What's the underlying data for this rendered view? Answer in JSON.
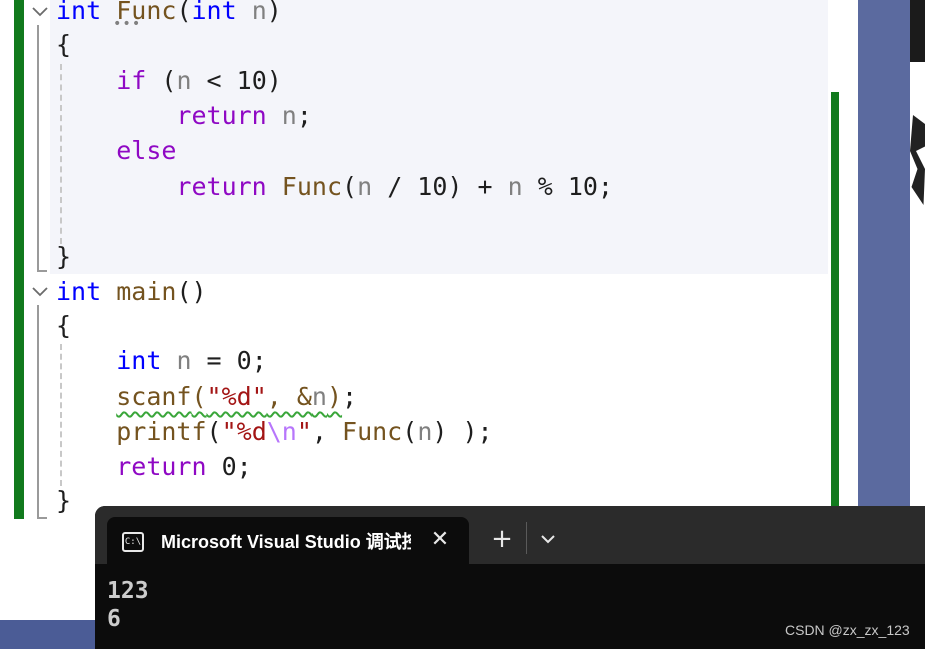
{
  "editor": {
    "lines": [
      {
        "tokens": [
          {
            "t": "int",
            "c": "kw"
          },
          {
            "t": " "
          },
          {
            "t": "Func",
            "c": "fn"
          },
          {
            "t": "("
          },
          {
            "t": "int",
            "c": "kw"
          },
          {
            "t": " "
          },
          {
            "t": "n",
            "c": "pn"
          },
          {
            "t": ")"
          }
        ]
      },
      {
        "tokens": [
          {
            "t": "{"
          }
        ]
      },
      {
        "tokens": [
          {
            "t": "    "
          },
          {
            "t": "if",
            "c": "ctl"
          },
          {
            "t": " ("
          },
          {
            "t": "n",
            "c": "pn"
          },
          {
            "t": " < 10)"
          }
        ]
      },
      {
        "tokens": [
          {
            "t": "        "
          },
          {
            "t": "return",
            "c": "ctl"
          },
          {
            "t": " "
          },
          {
            "t": "n",
            "c": "pn"
          },
          {
            "t": ";"
          }
        ]
      },
      {
        "tokens": [
          {
            "t": "    "
          },
          {
            "t": "else",
            "c": "ctl"
          }
        ]
      },
      {
        "tokens": [
          {
            "t": "        "
          },
          {
            "t": "return",
            "c": "ctl"
          },
          {
            "t": " "
          },
          {
            "t": "Func",
            "c": "fn"
          },
          {
            "t": "("
          },
          {
            "t": "n",
            "c": "pn"
          },
          {
            "t": " / 10) + "
          },
          {
            "t": "n",
            "c": "pn"
          },
          {
            "t": " % 10;"
          }
        ]
      },
      {
        "tokens": [
          {
            "t": ""
          }
        ]
      },
      {
        "tokens": [
          {
            "t": "}"
          }
        ]
      },
      {
        "tokens": [
          {
            "t": "int",
            "c": "kw"
          },
          {
            "t": " "
          },
          {
            "t": "main",
            "c": "fn"
          },
          {
            "t": "()"
          }
        ]
      },
      {
        "tokens": [
          {
            "t": "{"
          }
        ]
      },
      {
        "tokens": [
          {
            "t": "    "
          },
          {
            "t": "int",
            "c": "kw"
          },
          {
            "t": " "
          },
          {
            "t": "n",
            "c": "pn"
          },
          {
            "t": " = 0;"
          }
        ]
      },
      {
        "tokens": [
          {
            "t": "    "
          },
          {
            "t": "scanf(\"%d\", &n)",
            "c": "fn",
            "sq": true
          },
          {
            "t": ";"
          }
        ]
      },
      {
        "tokens": [
          {
            "t": "    "
          },
          {
            "t": "printf",
            "c": "fn"
          },
          {
            "t": "("
          },
          {
            "t": "\"%d",
            "c": "str"
          },
          {
            "t": "\\n",
            "c": "esc"
          },
          {
            "t": "\"",
            "c": "str"
          },
          {
            "t": ", "
          },
          {
            "t": "Func",
            "c": "fn"
          },
          {
            "t": "("
          },
          {
            "t": "n",
            "c": "pn"
          },
          {
            "t": ") );"
          }
        ]
      },
      {
        "tokens": [
          {
            "t": "    "
          },
          {
            "t": "return",
            "c": "ctl"
          },
          {
            "t": " 0;"
          }
        ]
      },
      {
        "tokens": [
          {
            "t": "}"
          }
        ]
      }
    ]
  },
  "console": {
    "tab_title": "Microsoft Visual Studio 调试控制台",
    "close_glyph": "✕",
    "new_tab_glyph": "+",
    "output": [
      "123",
      "6"
    ]
  },
  "watermark": "CSDN @zx_zx_123",
  "icons": {
    "fold": "chevron-down-icon",
    "console": "console-app-icon",
    "close": "close-icon",
    "new_tab": "plus-icon",
    "dropdown": "chevron-down-icon"
  },
  "colors": {
    "keyword": "#0000ff",
    "control": "#8f08c4",
    "function": "#74531f",
    "param": "#808080",
    "string": "#a31515",
    "escape": "#b776fb",
    "change_bar": "#117a1d",
    "console_bg": "#0c0c0c"
  }
}
